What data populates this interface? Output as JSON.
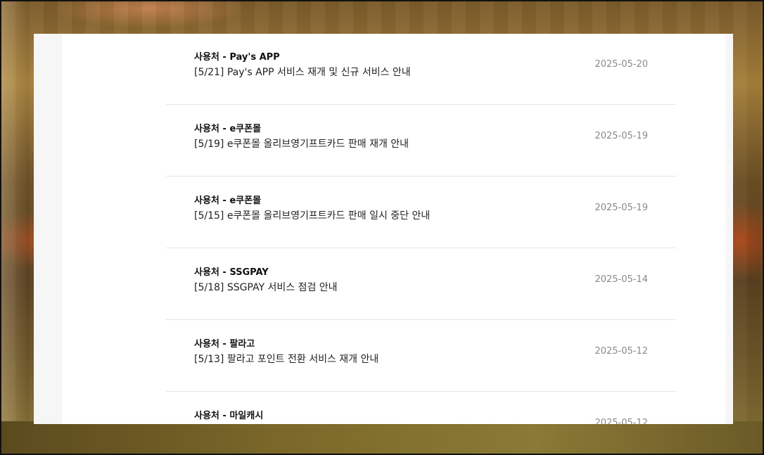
{
  "notices": [
    {
      "category": "사용처 - Pay's APP",
      "title": "[5/21] Pay's APP 서비스 재개 및 신규 서비스 안내",
      "date": "2025-05-20"
    },
    {
      "category": "사용처 - e쿠폰몰",
      "title": "[5/19] e쿠폰몰 올리브영기프트카드 판매 재개 안내",
      "date": "2025-05-19"
    },
    {
      "category": "사용처 - e쿠폰몰",
      "title": "[5/15] e쿠폰몰 올리브영기프트카드 판매 일시 중단 안내",
      "date": "2025-05-19"
    },
    {
      "category": "사용처 - SSGPAY",
      "title": "[5/18] SSGPAY 서비스 점검 안내",
      "date": "2025-05-14"
    },
    {
      "category": "사용처 - 팔라고",
      "title": "[5/13] 팔라고 포인트 전환 서비스 재개 안내",
      "date": "2025-05-12"
    },
    {
      "category": "사용처 - 마일캐시",
      "title": "",
      "date": "2025-05-12"
    }
  ]
}
